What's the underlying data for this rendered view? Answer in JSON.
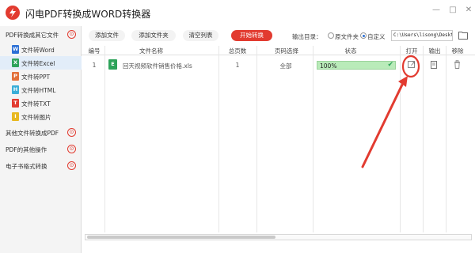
{
  "window": {
    "title": "闪电PDF转换成WORD转换器",
    "min_glyph": "—",
    "max_glyph": "□",
    "close_glyph": "✕"
  },
  "toolbar": {
    "add_file": "添加文件",
    "add_folder": "添加文件夹",
    "clear_list": "清空列表",
    "start_convert": "开始转换",
    "output_dir_label": "输出目录：",
    "option_source": "原文件夹",
    "option_custom": "自定义",
    "selected_option": "custom",
    "output_path": "C:\\Users\\lisong\\Desktop"
  },
  "sidebar": {
    "categories": [
      {
        "label": "PDF转换成其它文件",
        "toggle": "⊙",
        "expanded": true,
        "items": [
          {
            "icon_letter": "W",
            "icon_color": "#2b6fd6",
            "label": "文件转Word"
          },
          {
            "icon_letter": "X",
            "icon_color": "#2ea35a",
            "label": "文件转Excel",
            "active": true
          },
          {
            "icon_letter": "P",
            "icon_color": "#e2703a",
            "label": "文件转PPT"
          },
          {
            "icon_letter": "H",
            "icon_color": "#3aaed8",
            "label": "文件转HTML"
          },
          {
            "icon_letter": "T",
            "icon_color": "#e23b30",
            "label": "文件转TXT"
          },
          {
            "icon_letter": "I",
            "icon_color": "#e8b820",
            "label": "文件转图片"
          }
        ]
      },
      {
        "label": "其他文件转换成PDF",
        "toggle": "⊙",
        "expanded": false
      },
      {
        "label": "PDF的其他操作",
        "toggle": "⊙",
        "expanded": false
      },
      {
        "label": "电子书格式转换",
        "toggle": "⊙",
        "expanded": false
      }
    ]
  },
  "table": {
    "headers": [
      "编号",
      "文件名称",
      "总页数",
      "页码选择",
      "状态",
      "打开",
      "输出",
      "移除"
    ],
    "rows": [
      {
        "index": "1",
        "file_icon": "E",
        "file_name": "回天视频软件销售价格.xls",
        "total_pages": "1",
        "page_selection": "全部",
        "progress_text": "100%",
        "progress_fraction": 1.0
      }
    ]
  },
  "colors": {
    "accent": "#e23b30",
    "sidebar_active": "#e2edf9",
    "progress": "#c9f0c9"
  },
  "annotation": {
    "color": "#e23b30",
    "shape": "ellipse-with-arrow",
    "target": "open-button"
  }
}
